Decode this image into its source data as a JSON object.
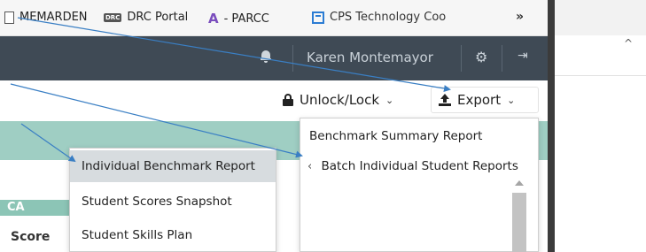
{
  "bookmarks": {
    "items": [
      {
        "label": "MEMARDEN",
        "icon": "page-icon"
      },
      {
        "label": "DRC Portal",
        "icon": "drc-icon",
        "badge": "DRC"
      },
      {
        "label": "- PARCC",
        "icon": "parcc-a-icon",
        "glyph": "A"
      },
      {
        "label": "CPS Technology Coo",
        "icon": "cps-icon"
      }
    ],
    "more": "»"
  },
  "topnav": {
    "user_name": "Karen Montemayor",
    "icons": [
      "bell-icon",
      "gear-icon",
      "sign-out-icon"
    ]
  },
  "toolbar": {
    "unlock_label": "Unlock/Lock",
    "export_label": "Export",
    "chevron": "⌄"
  },
  "export_menu": {
    "items": [
      "Benchmark Summary Report",
      "Batch Individual Student Reports"
    ],
    "submenu_glyph": "‹"
  },
  "report_menu": {
    "items": [
      "Individual Benchmark Report",
      "Student Scores Snapshot",
      "Student Skills Plan"
    ],
    "highlighted_index": 0
  },
  "content": {
    "tab_label": "CA",
    "column_header": "Score"
  },
  "right_panel": {
    "collapse_glyph": "^"
  },
  "colors": {
    "nav_bg": "#3f4a55",
    "teal_band": "#9fcec3",
    "highlight": "#d7dcdf",
    "arrow": "#3a7fc4"
  }
}
